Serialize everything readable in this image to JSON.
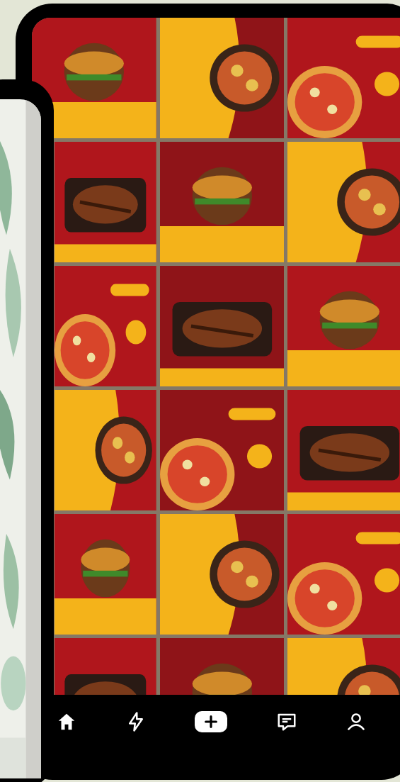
{
  "bottom_nav": {
    "items": [
      {
        "kind": "home"
      },
      {
        "kind": "bolt"
      },
      {
        "kind": "create"
      },
      {
        "kind": "message"
      },
      {
        "kind": "profile"
      }
    ]
  }
}
